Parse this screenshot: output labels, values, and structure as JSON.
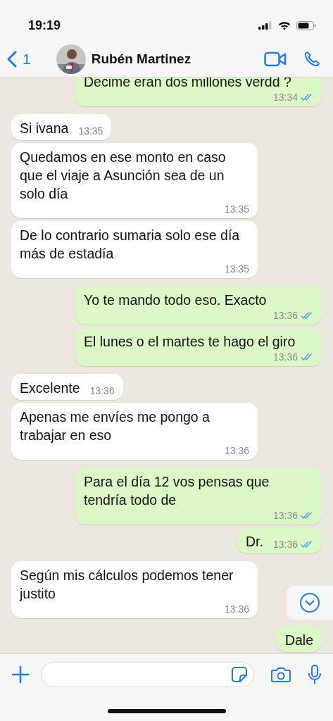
{
  "status_bar": {
    "time": "19:19"
  },
  "header": {
    "back_count": "1",
    "contact_name": "Rubén Martinez"
  },
  "messages": [
    {
      "sent": true,
      "text": "Decime eran dos millones verdd ?",
      "time": "13:34",
      "read": true
    },
    {
      "sent": false,
      "text": "Si ivana",
      "time": "13:35"
    },
    {
      "sent": false,
      "text": "Quedamos en ese monto en caso que el viaje a Asunción sea de un solo día",
      "time": "13:35"
    },
    {
      "sent": false,
      "text": "De lo contrario sumaria solo ese día más de estadía",
      "time": "13:35"
    },
    {
      "sent": true,
      "text": "Yo te mando todo eso. Exacto",
      "time": "13:36",
      "read": true
    },
    {
      "sent": true,
      "text": "El lunes o el martes te hago el giro",
      "time": "13:36",
      "read": true
    },
    {
      "sent": false,
      "text": "Excelente",
      "time": "13:36"
    },
    {
      "sent": false,
      "text": "Apenas me envíes me pongo a trabajar en eso",
      "time": "13:36"
    },
    {
      "sent": true,
      "text": "Para el día 12 vos pensas que tendría todo de",
      "time": "13:36",
      "read": true
    },
    {
      "sent": true,
      "text": "Dr.",
      "time": "13:36",
      "read": true
    },
    {
      "sent": false,
      "text": "Según mis cálculos podemos tener justito",
      "time": "13:36"
    },
    {
      "sent": true,
      "text": "Dale"
    }
  ]
}
